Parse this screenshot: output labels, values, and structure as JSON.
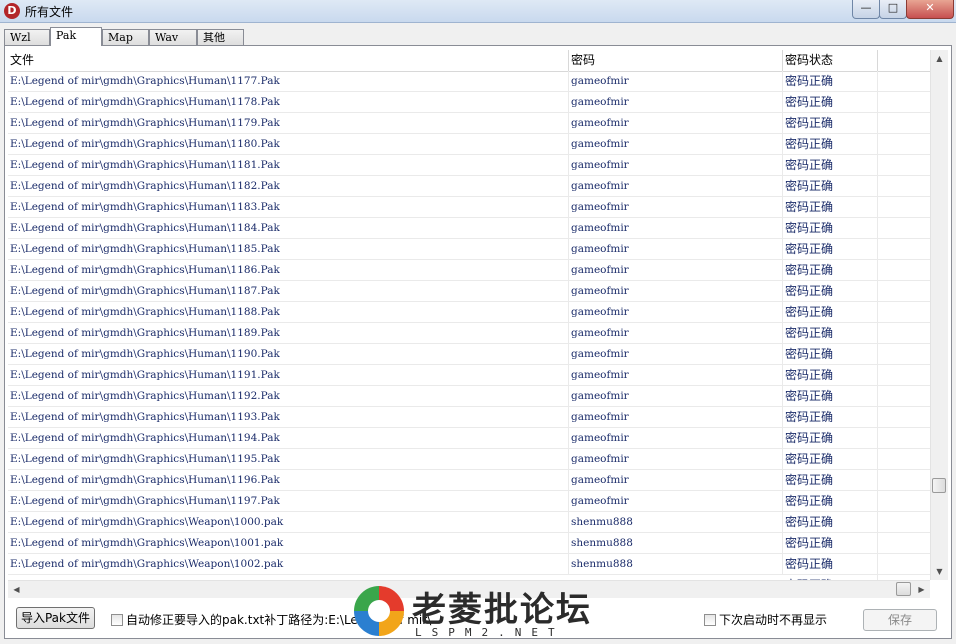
{
  "window": {
    "title": "所有文件",
    "app_icon_letter": "D",
    "min_glyph": "—",
    "max_glyph": "□",
    "close_glyph": "✕"
  },
  "tabs": [
    {
      "label": "Wzl",
      "active": false
    },
    {
      "label": "Pak",
      "active": true
    },
    {
      "label": "Map",
      "active": false
    },
    {
      "label": "Wav",
      "active": false
    },
    {
      "label": "其他",
      "active": false
    }
  ],
  "table": {
    "columns": [
      "文件",
      "密码",
      "密码状态"
    ],
    "rows": [
      [
        "E:\\Legend of mir\\gmdh\\Graphics\\Human\\1177.Pak",
        "gameofmir",
        "密码正确"
      ],
      [
        "E:\\Legend of mir\\gmdh\\Graphics\\Human\\1178.Pak",
        "gameofmir",
        "密码正确"
      ],
      [
        "E:\\Legend of mir\\gmdh\\Graphics\\Human\\1179.Pak",
        "gameofmir",
        "密码正确"
      ],
      [
        "E:\\Legend of mir\\gmdh\\Graphics\\Human\\1180.Pak",
        "gameofmir",
        "密码正确"
      ],
      [
        "E:\\Legend of mir\\gmdh\\Graphics\\Human\\1181.Pak",
        "gameofmir",
        "密码正确"
      ],
      [
        "E:\\Legend of mir\\gmdh\\Graphics\\Human\\1182.Pak",
        "gameofmir",
        "密码正确"
      ],
      [
        "E:\\Legend of mir\\gmdh\\Graphics\\Human\\1183.Pak",
        "gameofmir",
        "密码正确"
      ],
      [
        "E:\\Legend of mir\\gmdh\\Graphics\\Human\\1184.Pak",
        "gameofmir",
        "密码正确"
      ],
      [
        "E:\\Legend of mir\\gmdh\\Graphics\\Human\\1185.Pak",
        "gameofmir",
        "密码正确"
      ],
      [
        "E:\\Legend of mir\\gmdh\\Graphics\\Human\\1186.Pak",
        "gameofmir",
        "密码正确"
      ],
      [
        "E:\\Legend of mir\\gmdh\\Graphics\\Human\\1187.Pak",
        "gameofmir",
        "密码正确"
      ],
      [
        "E:\\Legend of mir\\gmdh\\Graphics\\Human\\1188.Pak",
        "gameofmir",
        "密码正确"
      ],
      [
        "E:\\Legend of mir\\gmdh\\Graphics\\Human\\1189.Pak",
        "gameofmir",
        "密码正确"
      ],
      [
        "E:\\Legend of mir\\gmdh\\Graphics\\Human\\1190.Pak",
        "gameofmir",
        "密码正确"
      ],
      [
        "E:\\Legend of mir\\gmdh\\Graphics\\Human\\1191.Pak",
        "gameofmir",
        "密码正确"
      ],
      [
        "E:\\Legend of mir\\gmdh\\Graphics\\Human\\1192.Pak",
        "gameofmir",
        "密码正确"
      ],
      [
        "E:\\Legend of mir\\gmdh\\Graphics\\Human\\1193.Pak",
        "gameofmir",
        "密码正确"
      ],
      [
        "E:\\Legend of mir\\gmdh\\Graphics\\Human\\1194.Pak",
        "gameofmir",
        "密码正确"
      ],
      [
        "E:\\Legend of mir\\gmdh\\Graphics\\Human\\1195.Pak",
        "gameofmir",
        "密码正确"
      ],
      [
        "E:\\Legend of mir\\gmdh\\Graphics\\Human\\1196.Pak",
        "gameofmir",
        "密码正确"
      ],
      [
        "E:\\Legend of mir\\gmdh\\Graphics\\Human\\1197.Pak",
        "gameofmir",
        "密码正确"
      ],
      [
        "E:\\Legend of mir\\gmdh\\Graphics\\Weapon\\1000.pak",
        "shenmu888",
        "密码正确"
      ],
      [
        "E:\\Legend of mir\\gmdh\\Graphics\\Weapon\\1001.pak",
        "shenmu888",
        "密码正确"
      ],
      [
        "E:\\Legend of mir\\gmdh\\Graphics\\Weapon\\1002.pak",
        "shenmu888",
        "密码正确"
      ]
    ],
    "partial_row_status": "密码正确"
  },
  "scrollbars": {
    "up_glyph": "▲",
    "down_glyph": "▼",
    "left_glyph": "◀",
    "right_glyph": "▶"
  },
  "footer": {
    "import_button": "导入Pak文件",
    "auto_fix_label": "自动修正要导入的pak.txt补丁路径为:E:\\Legend of mir\\",
    "auto_fix_checked": false,
    "no_show_label": "下次启动时不再显示",
    "no_show_checked": false,
    "save_button": "保存"
  },
  "watermark": {
    "text": "老菱批论坛",
    "sub": "LSPM2.NET"
  },
  "colors": {
    "cell_text": "#1b2c6a",
    "close_button": "#c75050"
  }
}
